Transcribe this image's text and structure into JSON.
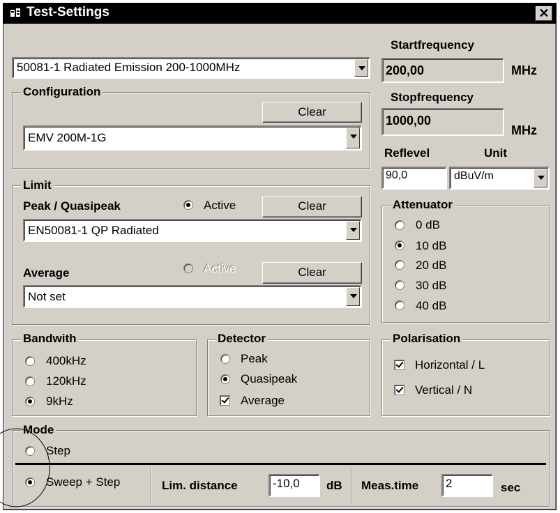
{
  "window": {
    "title": "Test-Settings",
    "close": "✕"
  },
  "test_select": {
    "value": "50081-1 Radiated Emission 200-1000MHz"
  },
  "configuration": {
    "legend": "Configuration",
    "clear": "Clear",
    "value": "EMV 200M-1G"
  },
  "start": {
    "label": "Startfrequency",
    "value": "200,00",
    "unit": "MHz"
  },
  "stop": {
    "label": "Stopfrequency",
    "value": "1000,00",
    "unit": "MHz"
  },
  "reflevel": {
    "label": "Reflevel",
    "value": "90,0"
  },
  "unit": {
    "label": "Unit",
    "value": "dBuV/m"
  },
  "limit": {
    "legend": "Limit",
    "peak_label": "Peak / Quasipeak",
    "peak_active": "Active",
    "peak_clear": "Clear",
    "peak_value": "EN50081-1 QP Radiated",
    "avg_label": "Average",
    "avg_active": "Active",
    "avg_clear": "Clear",
    "avg_value": "Not set"
  },
  "attenuator": {
    "legend": "Attenuator",
    "options": [
      "0 dB",
      "10 dB",
      "20 dB",
      "30 dB",
      "40 dB"
    ],
    "selected": 1
  },
  "bandwidth": {
    "legend": "Bandwith",
    "options": [
      "400kHz",
      "120kHz",
      "9kHz"
    ],
    "selected": 2
  },
  "detector": {
    "legend": "Detector",
    "peak": "Peak",
    "quasipeak": "Quasipeak",
    "average": "Average"
  },
  "polarisation": {
    "legend": "Polarisation",
    "horizontal": "Horizontal / L",
    "vertical": "Vertical / N"
  },
  "mode": {
    "legend": "Mode",
    "step": "Step",
    "sweep": "Sweep + Step",
    "lim_label": "Lim. distance",
    "lim_value": "-10,0",
    "lim_unit": "dB",
    "meas_label": "Meas.time",
    "meas_value": "2",
    "meas_unit": "sec"
  }
}
